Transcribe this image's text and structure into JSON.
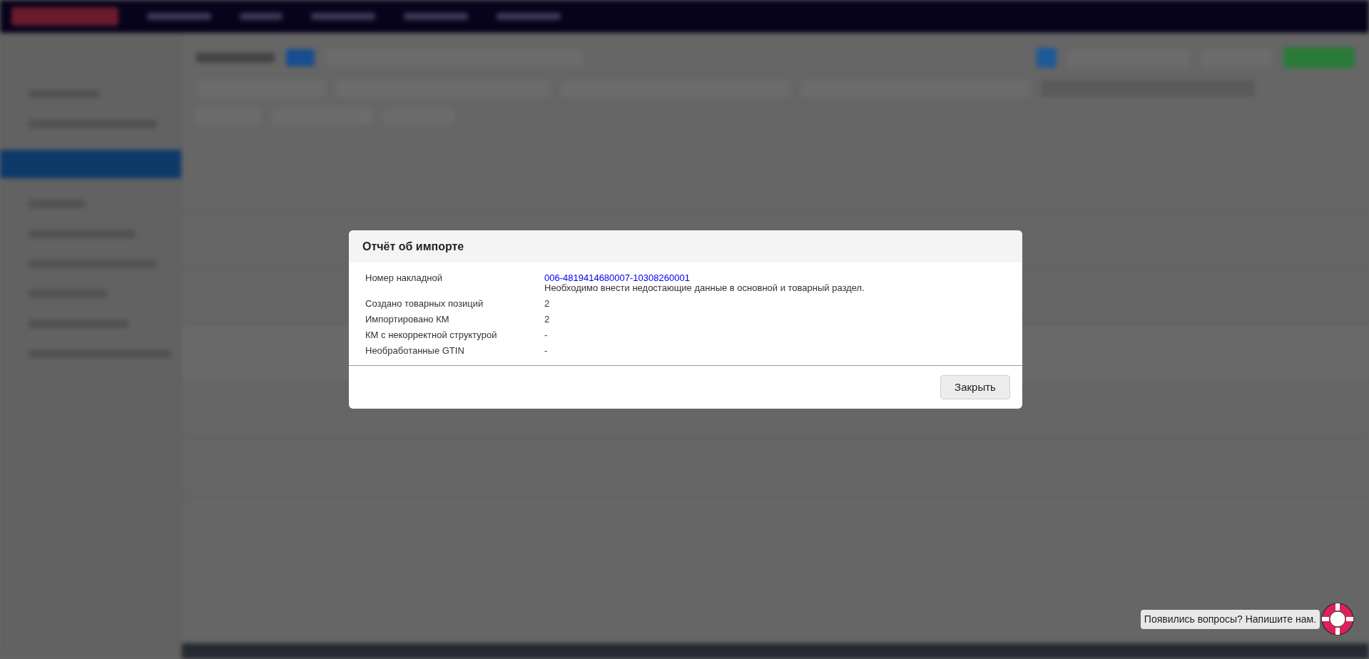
{
  "dialog": {
    "title": "Отчёт об импорте",
    "rows": [
      {
        "label": "Номер накладной",
        "value": "006-4819414680007-10308260001",
        "kind": "link",
        "note": "Необходимо внести недостающие данные в основной и товарный раздел."
      },
      {
        "label": "Создано товарных позиций",
        "value": "2",
        "kind": "text"
      },
      {
        "label": "Импортировано КМ",
        "value": "2",
        "kind": "text"
      },
      {
        "label": "КМ с некорректной структурой",
        "value": "-",
        "kind": "text"
      },
      {
        "label": "Необработанные GTIN",
        "value": "-",
        "kind": "text"
      }
    ],
    "close_button": "Закрыть"
  },
  "help_widget": {
    "text": "Появились вопросы? Напишите нам."
  }
}
